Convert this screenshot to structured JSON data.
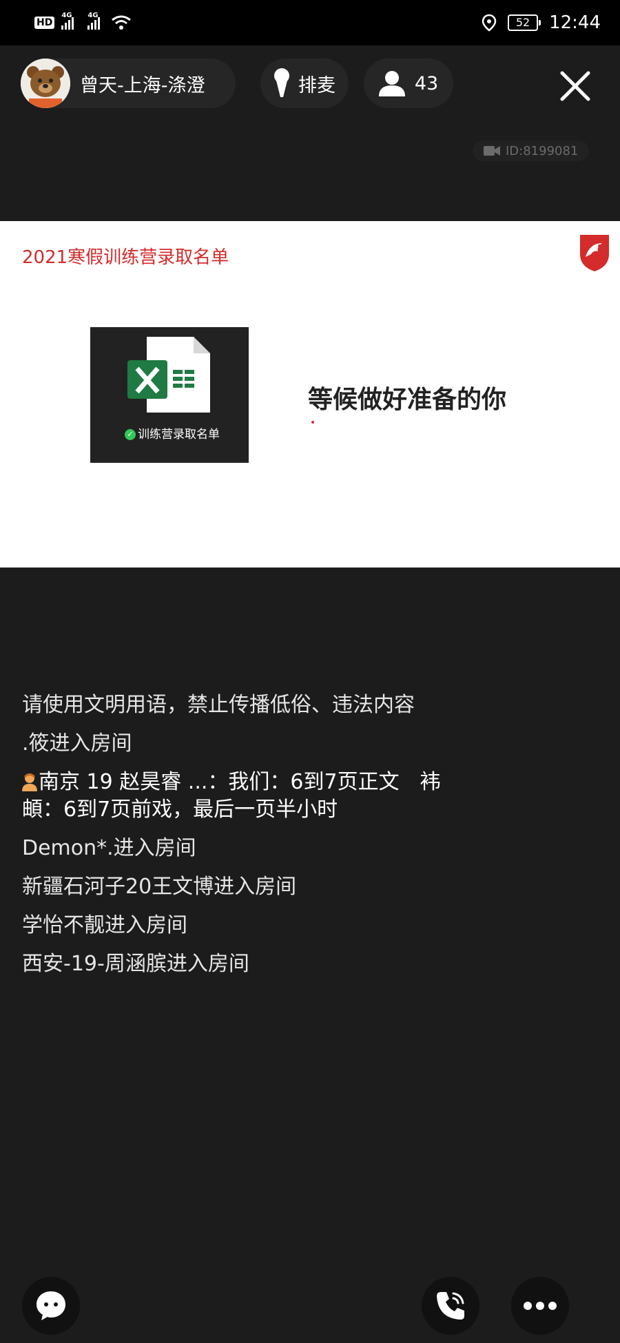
{
  "status_bar": {
    "hd_label": "HD",
    "net_label_1": "4G",
    "net_label_2": "4G",
    "battery_level": "52",
    "time": "12:44"
  },
  "header": {
    "host_name": "曾天-上海-涤澄",
    "mic_queue_label": "排麦",
    "viewer_count": "43",
    "room_id": "ID:8199081"
  },
  "slide": {
    "title": "2021寒假训练营录取名单",
    "file_name": "训练营录取名单",
    "headline": "等候做好准备的你",
    "accent_color": "#d42b2b"
  },
  "chat": {
    "messages": [
      "请使用文明用语，禁止传播低俗、违法内容",
      ".筱进入房间",
      "南京 19 赵昊睿 ...：我们：6到7页正文　袆頔：6到7页前戏，最后一页半小时",
      "Demon*.进入房间",
      "新疆石河子20王文博进入房间",
      "学怡不靓进入房间",
      "西安-19-周涵膑进入房间"
    ]
  },
  "icons": {
    "chat": "chat-bubble-icon",
    "call": "phone-icon",
    "more": "more-icon",
    "close": "close-icon",
    "mic": "microphone-icon",
    "viewer": "person-icon"
  }
}
